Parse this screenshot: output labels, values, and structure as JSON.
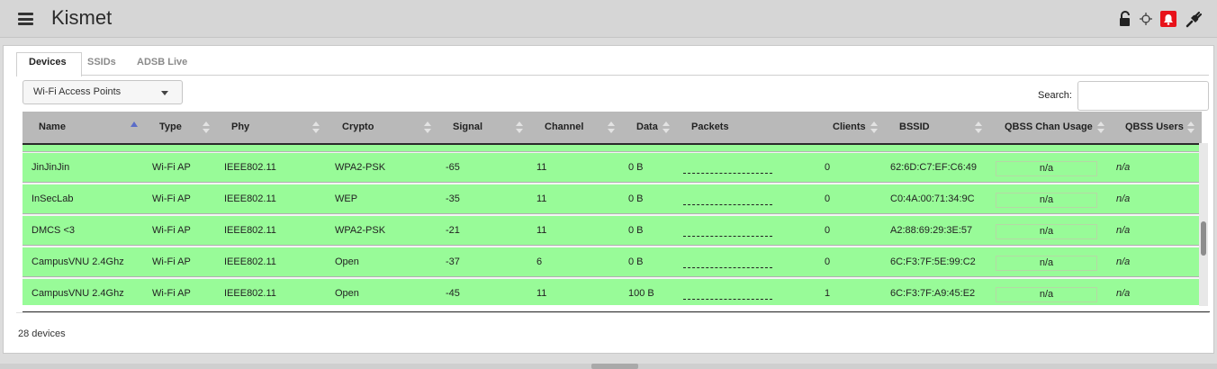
{
  "app": {
    "title": "Kismet"
  },
  "tabs": [
    "Devices",
    "SSIDs",
    "ADSB Live"
  ],
  "view_select": {
    "value": "Wi-Fi Access Points"
  },
  "search": {
    "label": "Search:",
    "value": ""
  },
  "table": {
    "columns": [
      "Name",
      "Type",
      "Phy",
      "Crypto",
      "Signal",
      "Channel",
      "Data",
      "Packets",
      "Clients",
      "BSSID",
      "QBSS Chan Usage",
      "QBSS Users"
    ],
    "sorted_column": "Name",
    "rows": [
      {
        "name": "JinJinJin",
        "type": "Wi-Fi AP",
        "phy": "IEEE802.11",
        "crypto": "WPA2-PSK",
        "signal": "-65",
        "channel": "11",
        "data": "0 B",
        "clients": "0",
        "bssid": "62:6D:C7:EF:C6:49",
        "qbss_chan": "n/a",
        "qbss_users": "n/a"
      },
      {
        "name": "InSecLab",
        "type": "Wi-Fi AP",
        "phy": "IEEE802.11",
        "crypto": "WEP",
        "signal": "-35",
        "channel": "11",
        "data": "0 B",
        "clients": "0",
        "bssid": "C0:4A:00:71:34:9C",
        "qbss_chan": "n/a",
        "qbss_users": "n/a"
      },
      {
        "name": "DMCS <3",
        "type": "Wi-Fi AP",
        "phy": "IEEE802.11",
        "crypto": "WPA2-PSK",
        "signal": "-21",
        "channel": "11",
        "data": "0 B",
        "clients": "0",
        "bssid": "A2:88:69:29:3E:57",
        "qbss_chan": "n/a",
        "qbss_users": "n/a"
      },
      {
        "name": "CampusVNU 2.4Ghz",
        "type": "Wi-Fi AP",
        "phy": "IEEE802.11",
        "crypto": "Open",
        "signal": "-37",
        "channel": "6",
        "data": "0 B",
        "clients": "0",
        "bssid": "6C:F3:7F:5E:99:C2",
        "qbss_chan": "n/a",
        "qbss_users": "n/a"
      },
      {
        "name": "CampusVNU 2.4Ghz",
        "type": "Wi-Fi AP",
        "phy": "IEEE802.11",
        "crypto": "Open",
        "signal": "-45",
        "channel": "11",
        "data": "100 B",
        "clients": "1",
        "bssid": "6C:F3:7F:A9:45:E2",
        "qbss_chan": "n/a",
        "qbss_users": "n/a"
      }
    ]
  },
  "footer": {
    "count": "28 devices"
  },
  "colors": {
    "row_bg": "#98fb98",
    "header_bg": "#b9b9b9",
    "alert": "#e8121a"
  },
  "icons": [
    "hamburger-menu-icon",
    "lock-open-icon",
    "crosshair-icon",
    "bell-alert-icon",
    "plug-icon"
  ]
}
